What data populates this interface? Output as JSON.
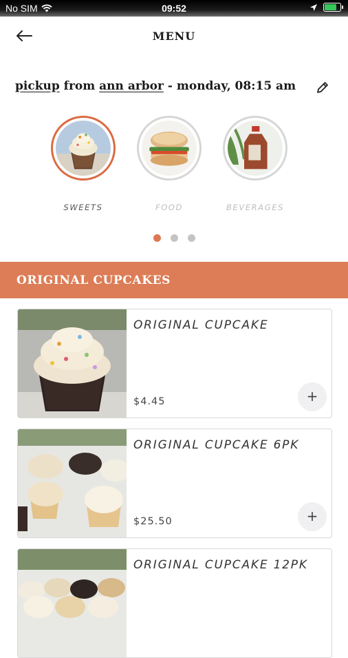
{
  "status_bar": {
    "carrier": "No SIM",
    "time": "09:52",
    "icons": [
      "wifi-icon",
      "location-arrow-icon",
      "battery-charging-icon"
    ]
  },
  "header": {
    "title": "MENU",
    "back_icon": "arrow-left-icon"
  },
  "pickup": {
    "mode": "pickup",
    "from_word": " from ",
    "location": "ann arbor",
    "datetime": " - monday, 08:15 am",
    "edit_icon": "pencil-icon"
  },
  "categories": [
    {
      "label": "SWEETS",
      "active": true,
      "image": "cupcake-photo"
    },
    {
      "label": "FOOD",
      "active": false,
      "image": "sandwich-photo"
    },
    {
      "label": "BEVERAGES",
      "active": false,
      "image": "tea-jug-photo"
    }
  ],
  "pager": {
    "count": 3,
    "active_index": 0
  },
  "section": {
    "title": "ORIGINAL CUPCAKES"
  },
  "products": [
    {
      "name": "ORIGINAL CUPCAKE",
      "price": "$4.45",
      "add_label": "+"
    },
    {
      "name": "ORIGINAL CUPCAKE 6PK",
      "price": "$25.50",
      "add_label": "+"
    },
    {
      "name": "ORIGINAL CUPCAKE 12PK",
      "price": "",
      "add_label": "+"
    }
  ],
  "colors": {
    "accent": "#dc7d57",
    "active_dot": "#db7a52",
    "active_ring": "#db6b43",
    "inactive_dot": "#c4c4c4"
  }
}
